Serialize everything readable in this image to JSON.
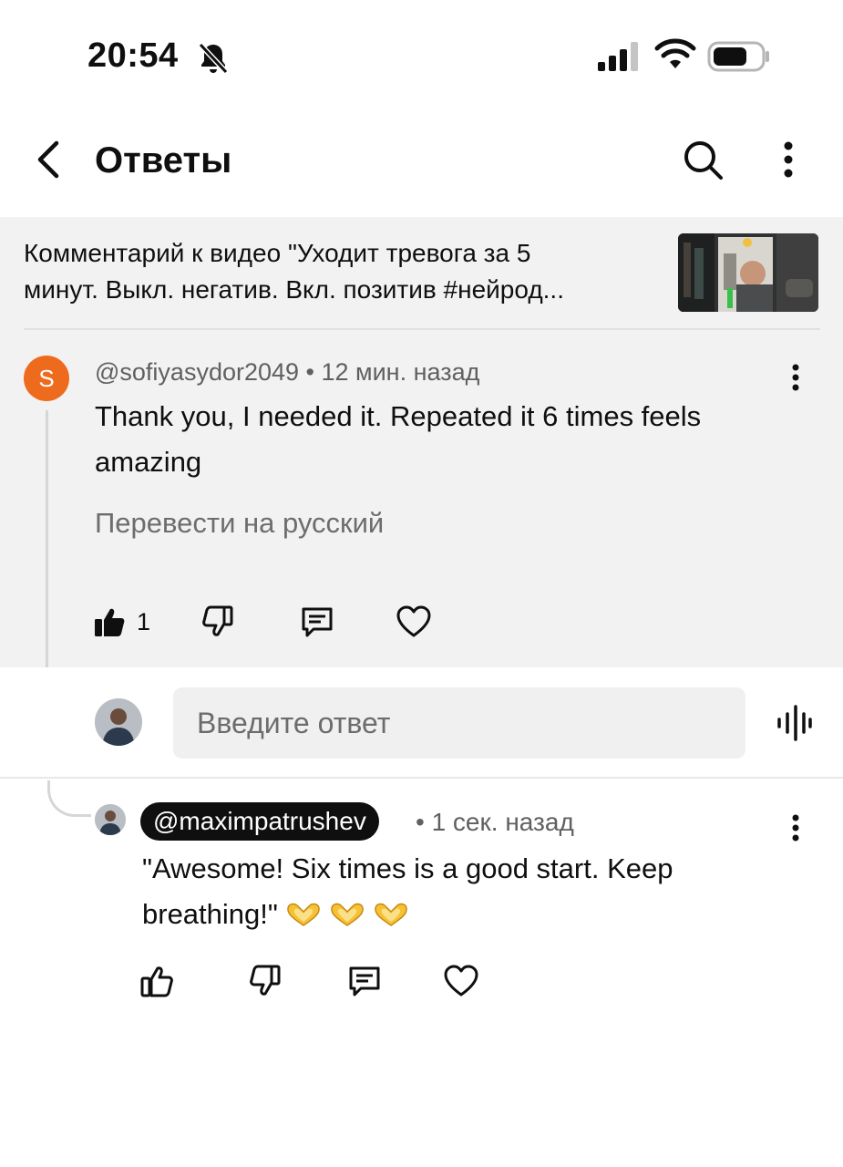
{
  "status_bar": {
    "time": "20:54",
    "icons": [
      "bell-slash-icon",
      "cellular-signal-icon",
      "wifi-icon",
      "battery-icon"
    ]
  },
  "header": {
    "title": "Ответы",
    "icons": [
      "back-arrow-icon",
      "search-icon",
      "more-vertical-icon"
    ]
  },
  "video": {
    "caption_line1": "Комментарий к видео \"Уходит тревога за 5",
    "caption_line2": "минут. Выкл. негатив. Вкл. позитив #нейрод..."
  },
  "parent_comment": {
    "avatar_letter": "S",
    "avatar_color": "#ee6a1d",
    "author": "@sofiyasydor2049",
    "time": "• 12 мин. назад",
    "text": "Thank you, I needed it. Repeated it 6 times feels amazing",
    "translate": "Перевести на русский",
    "likes": "1"
  },
  "reply_input": {
    "placeholder": "Введите ответ"
  },
  "reply": {
    "author": "@maximpatrushev",
    "time": "• 1 сек. назад",
    "text": "\"Awesome! Six times is a good start. Keep breathing!\"",
    "emojis": [
      "heart-hands-emoji",
      "heart-hands-emoji",
      "heart-hands-emoji"
    ]
  }
}
